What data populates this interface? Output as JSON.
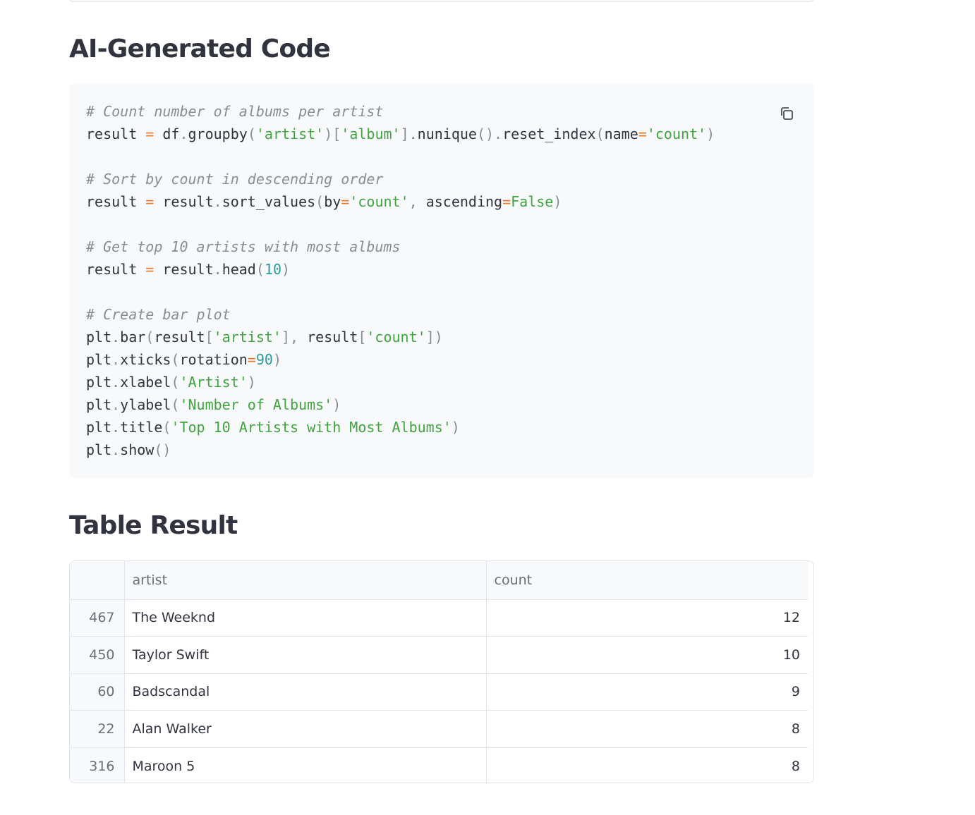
{
  "code_section": {
    "title": "AI-Generated Code",
    "copy_icon": "copy-icon",
    "lines": [
      [
        {
          "t": "cm",
          "v": "# Count number of albums per artist"
        }
      ],
      [
        {
          "t": "tx",
          "v": "result "
        },
        {
          "t": "op",
          "v": "="
        },
        {
          "t": "tx",
          "v": " df"
        },
        {
          "t": "pn",
          "v": "."
        },
        {
          "t": "tx",
          "v": "groupby"
        },
        {
          "t": "pn",
          "v": "("
        },
        {
          "t": "st",
          "v": "'artist'"
        },
        {
          "t": "pn",
          "v": ")["
        },
        {
          "t": "st",
          "v": "'album'"
        },
        {
          "t": "pn",
          "v": "]."
        },
        {
          "t": "tx",
          "v": "nunique"
        },
        {
          "t": "pn",
          "v": "()."
        },
        {
          "t": "tx",
          "v": "reset_index"
        },
        {
          "t": "pn",
          "v": "("
        },
        {
          "t": "tx",
          "v": "name"
        },
        {
          "t": "op",
          "v": "="
        },
        {
          "t": "st",
          "v": "'count'"
        },
        {
          "t": "pn",
          "v": ")"
        }
      ],
      [],
      [
        {
          "t": "cm",
          "v": "# Sort by count in descending order"
        }
      ],
      [
        {
          "t": "tx",
          "v": "result "
        },
        {
          "t": "op",
          "v": "="
        },
        {
          "t": "tx",
          "v": " result"
        },
        {
          "t": "pn",
          "v": "."
        },
        {
          "t": "tx",
          "v": "sort_values"
        },
        {
          "t": "pn",
          "v": "("
        },
        {
          "t": "tx",
          "v": "by"
        },
        {
          "t": "op",
          "v": "="
        },
        {
          "t": "st",
          "v": "'count'"
        },
        {
          "t": "pn",
          "v": ", "
        },
        {
          "t": "tx",
          "v": "ascending"
        },
        {
          "t": "op",
          "v": "="
        },
        {
          "t": "kw",
          "v": "False"
        },
        {
          "t": "pn",
          "v": ")"
        }
      ],
      [],
      [
        {
          "t": "cm",
          "v": "# Get top 10 artists with most albums"
        }
      ],
      [
        {
          "t": "tx",
          "v": "result "
        },
        {
          "t": "op",
          "v": "="
        },
        {
          "t": "tx",
          "v": " result"
        },
        {
          "t": "pn",
          "v": "."
        },
        {
          "t": "tx",
          "v": "head"
        },
        {
          "t": "pn",
          "v": "("
        },
        {
          "t": "nm",
          "v": "10"
        },
        {
          "t": "pn",
          "v": ")"
        }
      ],
      [],
      [
        {
          "t": "cm",
          "v": "# Create bar plot"
        }
      ],
      [
        {
          "t": "tx",
          "v": "plt"
        },
        {
          "t": "pn",
          "v": "."
        },
        {
          "t": "tx",
          "v": "bar"
        },
        {
          "t": "pn",
          "v": "("
        },
        {
          "t": "tx",
          "v": "result"
        },
        {
          "t": "pn",
          "v": "["
        },
        {
          "t": "st",
          "v": "'artist'"
        },
        {
          "t": "pn",
          "v": "], "
        },
        {
          "t": "tx",
          "v": "result"
        },
        {
          "t": "pn",
          "v": "["
        },
        {
          "t": "st",
          "v": "'count'"
        },
        {
          "t": "pn",
          "v": "])"
        }
      ],
      [
        {
          "t": "tx",
          "v": "plt"
        },
        {
          "t": "pn",
          "v": "."
        },
        {
          "t": "tx",
          "v": "xticks"
        },
        {
          "t": "pn",
          "v": "("
        },
        {
          "t": "tx",
          "v": "rotation"
        },
        {
          "t": "op",
          "v": "="
        },
        {
          "t": "nm",
          "v": "90"
        },
        {
          "t": "pn",
          "v": ")"
        }
      ],
      [
        {
          "t": "tx",
          "v": "plt"
        },
        {
          "t": "pn",
          "v": "."
        },
        {
          "t": "tx",
          "v": "xlabel"
        },
        {
          "t": "pn",
          "v": "("
        },
        {
          "t": "st",
          "v": "'Artist'"
        },
        {
          "t": "pn",
          "v": ")"
        }
      ],
      [
        {
          "t": "tx",
          "v": "plt"
        },
        {
          "t": "pn",
          "v": "."
        },
        {
          "t": "tx",
          "v": "ylabel"
        },
        {
          "t": "pn",
          "v": "("
        },
        {
          "t": "st",
          "v": "'Number of Albums'"
        },
        {
          "t": "pn",
          "v": ")"
        }
      ],
      [
        {
          "t": "tx",
          "v": "plt"
        },
        {
          "t": "pn",
          "v": "."
        },
        {
          "t": "tx",
          "v": "title"
        },
        {
          "t": "pn",
          "v": "("
        },
        {
          "t": "st",
          "v": "'Top 10 Artists with Most Albums'"
        },
        {
          "t": "pn",
          "v": ")"
        }
      ],
      [
        {
          "t": "tx",
          "v": "plt"
        },
        {
          "t": "pn",
          "v": "."
        },
        {
          "t": "tx",
          "v": "show"
        },
        {
          "t": "pn",
          "v": "()"
        }
      ]
    ]
  },
  "table_section": {
    "title": "Table Result",
    "columns": [
      "",
      "artist",
      "count"
    ],
    "rows": [
      {
        "index": "467",
        "artist": "The Weeknd",
        "count": "12"
      },
      {
        "index": "450",
        "artist": "Taylor Swift",
        "count": "10"
      },
      {
        "index": "60",
        "artist": "Badscandal",
        "count": "9"
      },
      {
        "index": "22",
        "artist": "Alan Walker",
        "count": "8"
      },
      {
        "index": "316",
        "artist": "Maroon 5",
        "count": "8"
      }
    ]
  },
  "colors": {
    "comment": "#8a8c95",
    "string": "#3fa33f",
    "number": "#2a9c9c",
    "operator": "#e67c2f",
    "text": "#31333f",
    "code_bg": "#f8f9fb",
    "border": "#e1e4ea"
  }
}
